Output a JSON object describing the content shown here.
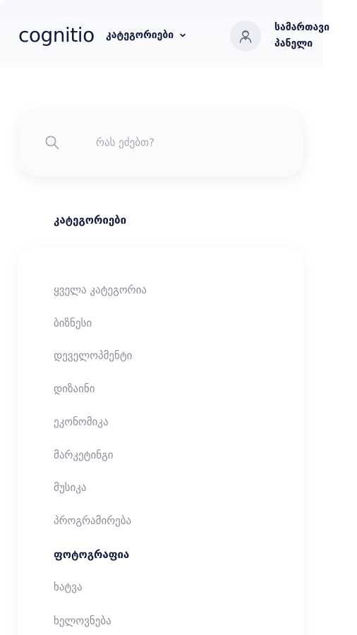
{
  "header": {
    "logo": "cognitio",
    "categories_toggle": "კატეგორიები",
    "avatar_icon": "user-avatar-icon",
    "dashboard_line1": "სამართავი",
    "dashboard_line2": "პანელი"
  },
  "search": {
    "placeholder": "რას ეძებთ?",
    "icon": "search-icon"
  },
  "categories": {
    "title": "კატეგორიები",
    "active_index": 8,
    "items": [
      "ყველა კატეგორია",
      "ბიზნესი",
      "დეველოპმენტი",
      "დიზაინი",
      "ეკონომიკა",
      "მარკეტინგი",
      "მუსიკა",
      "პროგრამირება",
      "ფოტოგრაფია",
      "ხატვა",
      "ხელოვნება"
    ]
  },
  "colors": {
    "text_primary": "#141a3a",
    "text_muted": "#8a8e9b",
    "placeholder": "#a5a9b6"
  }
}
